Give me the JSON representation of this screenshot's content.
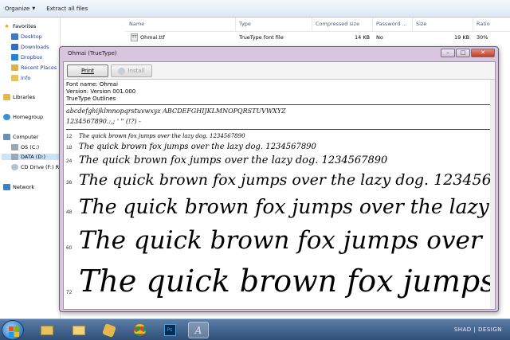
{
  "explorer": {
    "toolbar": {
      "organize": "Organize",
      "extract": "Extract all files"
    },
    "nav": {
      "favorites": "Favorites",
      "favorites_items": [
        "Desktop",
        "Downloads",
        "Dropbox",
        "Recent Places",
        "Info"
      ],
      "libraries": "Libraries",
      "homegroup": "Homegroup",
      "computer": "Computer",
      "computer_items": [
        "OS (C:)",
        "DATA (D:)",
        "CD Drive (F:) R"
      ],
      "network": "Network"
    },
    "columns": [
      "Name",
      "Type",
      "Compressed size",
      "Password ...",
      "Size",
      "Ratio"
    ],
    "file": {
      "name": "Ohmai.ttf",
      "type": "TrueType font file",
      "compressed": "14 KB",
      "password": "No",
      "size": "19 KB",
      "ratio": "30%"
    }
  },
  "viewer": {
    "title": "Ohmai (TrueType)",
    "print_label": "Print",
    "install_label": "Install",
    "info": {
      "font_name": "Font name: Ohmai",
      "version": "Version: Version 001.000",
      "outlines": "TrueType Outlines"
    },
    "charset_lines": [
      "abcdefghijklmnopqrstuvwxyz ABCDEFGHIJKLMNOPQRSTUVWXYZ",
      "1234567890.:,; ' \" (!?) -"
    ],
    "sample_text": "The quick brown fox jumps over the lazy dog. 1234567890",
    "sizes": [
      "12",
      "18",
      "24",
      "36",
      "48",
      "60",
      "72"
    ]
  },
  "taskbar": {
    "items": [
      "explorer",
      "folder",
      "pinned-app",
      "chrome",
      "photoshop",
      "font-viewer"
    ],
    "watermark": "SHAD | DESIGN"
  },
  "colors": {
    "window_frame": "#d7c6de",
    "taskbar": "#3f6290",
    "link_blue": "#1b3f9a"
  }
}
